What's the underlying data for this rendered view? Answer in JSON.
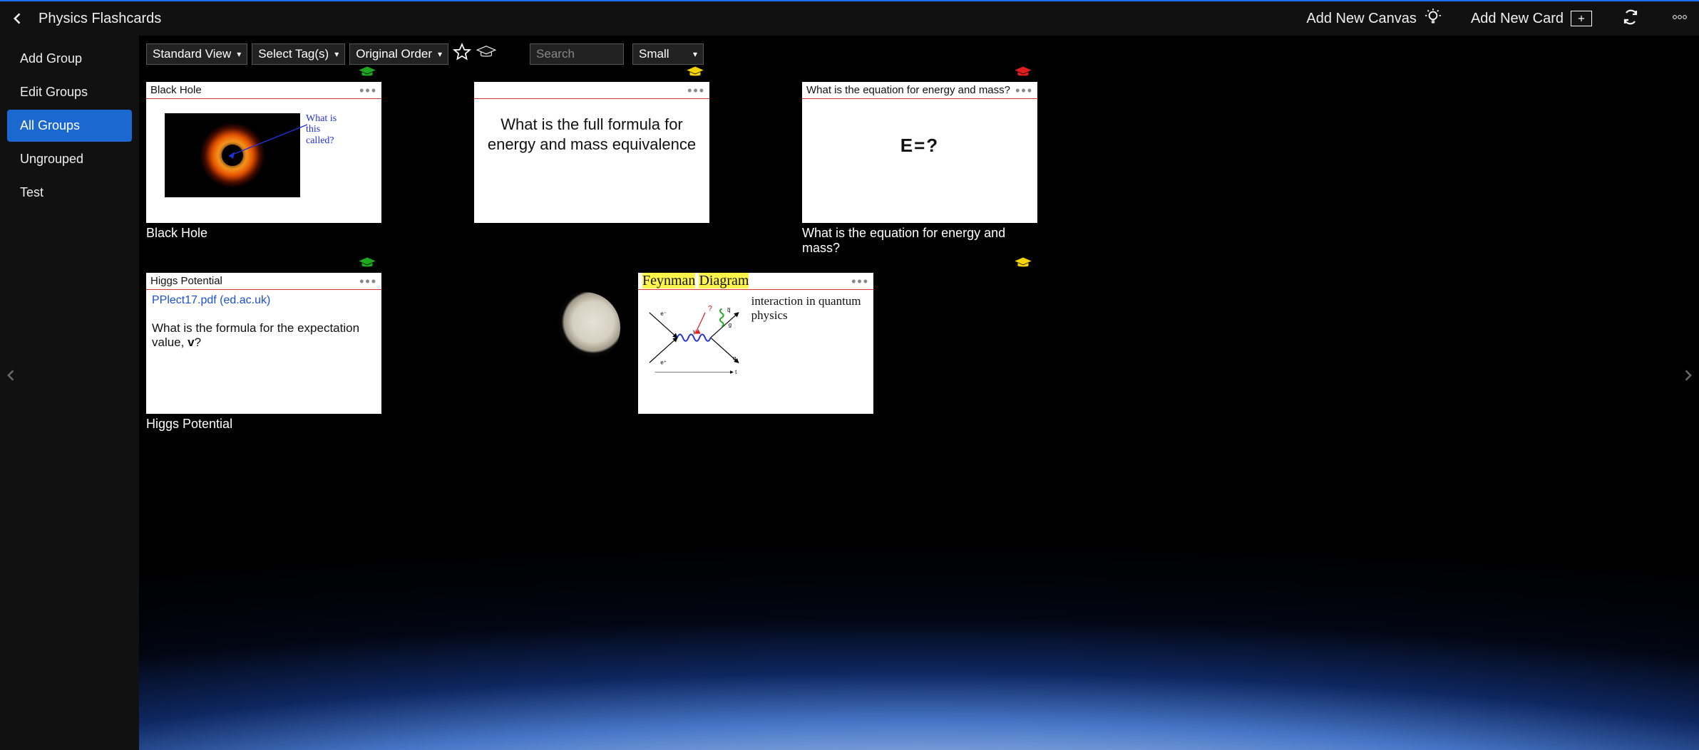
{
  "header": {
    "title": "Physics Flashcards",
    "add_canvas": "Add New Canvas",
    "add_card": "Add New Card"
  },
  "sidebar": {
    "items": [
      {
        "label": "Add Group"
      },
      {
        "label": "Edit Groups"
      },
      {
        "label": "All Groups"
      },
      {
        "label": "Ungrouped"
      },
      {
        "label": "Test"
      }
    ],
    "active_index": 2
  },
  "toolbar": {
    "view_select": "Standard View",
    "tag_select": "Select Tag(s)",
    "order_select": "Original Order",
    "search_placeholder": "Search",
    "size_select": "Small"
  },
  "cards": [
    {
      "grad_color": "green",
      "header": "Black Hole",
      "caption": "Black Hole",
      "handnote_l1": "What is",
      "handnote_l2": "this",
      "handnote_l3": "called?"
    },
    {
      "grad_color": "yellow",
      "header": "",
      "caption": "",
      "big_question": "What is the full formula for energy and mass equivalence"
    },
    {
      "grad_color": "red",
      "header": "What is the equation for energy and mass?",
      "caption": "What is the equation for energy and mass?",
      "equation": "E=?"
    },
    {
      "grad_color": "green",
      "header": "Higgs Potential",
      "caption": "Higgs Potential",
      "link_text": "PPlect17.pdf (ed.ac.uk)",
      "question_pre": "What is the formula for the expectation value, ",
      "question_bold": "v",
      "question_post": "?"
    },
    {
      "grad_color": "yellow",
      "header": "",
      "caption": "",
      "feyn_title_a": "Feynman",
      "feyn_title_b": "Diagram",
      "labels": {
        "tl": "e⁻",
        "bl": "e⁺",
        "tr": "q̅",
        "br": "q",
        "mid": "γ",
        "g": "g",
        "t": "t"
      },
      "handnote": "interaction in quantum physics"
    }
  ]
}
